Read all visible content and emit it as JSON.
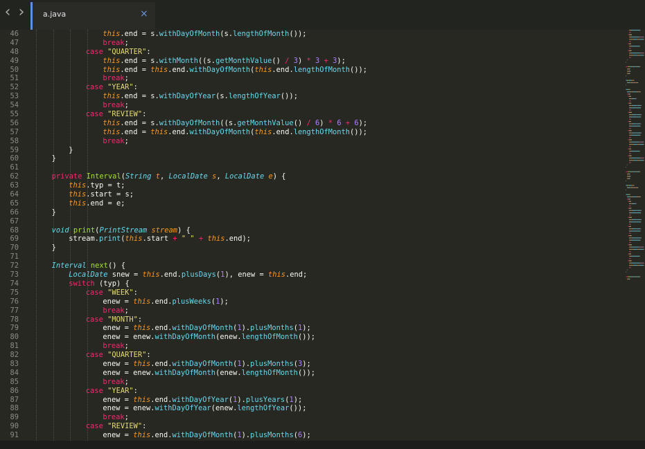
{
  "tabbar": {
    "back_glyph": "‹",
    "forward_glyph": "›",
    "tab": {
      "label": "a.java",
      "close_glyph": "×"
    }
  },
  "icons": [
    "chevron-left-icon",
    "chevron-right-icon",
    "close-icon"
  ],
  "colors": {
    "accent": "#5f8fe0",
    "background": "#272822",
    "keyword": "#f92672",
    "type": "#66d9ef",
    "function": "#a6e22e",
    "string": "#e6db74",
    "number": "#ae81ff",
    "this": "#fd971f"
  },
  "editor": {
    "lines": [
      {
        "n": "46",
        "i": 4,
        "t": [
          [
            "this",
            "this"
          ],
          [
            "pl",
            ".end = s."
          ],
          [
            "mt",
            "withDayOfMonth"
          ],
          [
            "pl",
            "(s."
          ],
          [
            "mt",
            "lengthOfMonth"
          ],
          [
            "pl",
            "());"
          ]
        ]
      },
      {
        "n": "47",
        "i": 4,
        "t": [
          [
            "kw",
            "break"
          ],
          [
            "pl",
            ";"
          ]
        ]
      },
      {
        "n": "48",
        "i": 3,
        "t": [
          [
            "kw",
            "case "
          ],
          [
            "str",
            "\"QUARTER\""
          ],
          [
            "pl",
            ":"
          ]
        ]
      },
      {
        "n": "49",
        "i": 4,
        "t": [
          [
            "this",
            "this"
          ],
          [
            "pl",
            ".end = s."
          ],
          [
            "mt",
            "withMonth"
          ],
          [
            "pl",
            "((s."
          ],
          [
            "mt",
            "getMonthValue"
          ],
          [
            "pl",
            "() "
          ],
          [
            "op",
            "/"
          ],
          [
            "pl",
            " "
          ],
          [
            "num",
            "3"
          ],
          [
            "pl",
            ") "
          ],
          [
            "op",
            "*"
          ],
          [
            "pl",
            " "
          ],
          [
            "num",
            "3"
          ],
          [
            "pl",
            " "
          ],
          [
            "op",
            "+"
          ],
          [
            "pl",
            " "
          ],
          [
            "num",
            "3"
          ],
          [
            "pl",
            ");"
          ]
        ]
      },
      {
        "n": "50",
        "i": 4,
        "t": [
          [
            "this",
            "this"
          ],
          [
            "pl",
            ".end = "
          ],
          [
            "this",
            "this"
          ],
          [
            "pl",
            ".end."
          ],
          [
            "mt",
            "withDayOfMonth"
          ],
          [
            "pl",
            "("
          ],
          [
            "this",
            "this"
          ],
          [
            "pl",
            ".end."
          ],
          [
            "mt",
            "lengthOfMonth"
          ],
          [
            "pl",
            "());"
          ]
        ]
      },
      {
        "n": "51",
        "i": 4,
        "t": [
          [
            "kw",
            "break"
          ],
          [
            "pl",
            ";"
          ]
        ]
      },
      {
        "n": "52",
        "i": 3,
        "t": [
          [
            "kw",
            "case "
          ],
          [
            "str",
            "\"YEAR\""
          ],
          [
            "pl",
            ":"
          ]
        ]
      },
      {
        "n": "53",
        "i": 4,
        "t": [
          [
            "this",
            "this"
          ],
          [
            "pl",
            ".end = s."
          ],
          [
            "mt",
            "withDayOfYear"
          ],
          [
            "pl",
            "(s."
          ],
          [
            "mt",
            "lengthOfYear"
          ],
          [
            "pl",
            "());"
          ]
        ]
      },
      {
        "n": "54",
        "i": 4,
        "t": [
          [
            "kw",
            "break"
          ],
          [
            "pl",
            ";"
          ]
        ]
      },
      {
        "n": "55",
        "i": 3,
        "t": [
          [
            "kw",
            "case "
          ],
          [
            "str",
            "\"REVIEW\""
          ],
          [
            "pl",
            ":"
          ]
        ]
      },
      {
        "n": "56",
        "i": 4,
        "t": [
          [
            "this",
            "this"
          ],
          [
            "pl",
            ".end = s."
          ],
          [
            "mt",
            "withDayOfMonth"
          ],
          [
            "pl",
            "((s."
          ],
          [
            "mt",
            "getMonthValue"
          ],
          [
            "pl",
            "() "
          ],
          [
            "op",
            "/"
          ],
          [
            "pl",
            " "
          ],
          [
            "num",
            "6"
          ],
          [
            "pl",
            ") "
          ],
          [
            "op",
            "*"
          ],
          [
            "pl",
            " "
          ],
          [
            "num",
            "6"
          ],
          [
            "pl",
            " "
          ],
          [
            "op",
            "+"
          ],
          [
            "pl",
            " "
          ],
          [
            "num",
            "6"
          ],
          [
            "pl",
            ");"
          ]
        ]
      },
      {
        "n": "57",
        "i": 4,
        "t": [
          [
            "this",
            "this"
          ],
          [
            "pl",
            ".end = "
          ],
          [
            "this",
            "this"
          ],
          [
            "pl",
            ".end."
          ],
          [
            "mt",
            "withDayOfMonth"
          ],
          [
            "pl",
            "("
          ],
          [
            "this",
            "this"
          ],
          [
            "pl",
            ".end."
          ],
          [
            "mt",
            "lengthOfMonth"
          ],
          [
            "pl",
            "());"
          ]
        ]
      },
      {
        "n": "58",
        "i": 4,
        "t": [
          [
            "kw",
            "break"
          ],
          [
            "pl",
            ";"
          ]
        ]
      },
      {
        "n": "59",
        "i": 2,
        "t": [
          [
            "pl",
            "}"
          ]
        ]
      },
      {
        "n": "60",
        "i": 1,
        "t": [
          [
            "pl",
            "}"
          ]
        ]
      },
      {
        "n": "61",
        "i": 0,
        "t": []
      },
      {
        "n": "62",
        "i": 1,
        "t": [
          [
            "kw",
            "private "
          ],
          [
            "fn",
            "Interval"
          ],
          [
            "pl",
            "("
          ],
          [
            "ty",
            "String"
          ],
          [
            "pl",
            " "
          ],
          [
            "par",
            "t"
          ],
          [
            "pl",
            ", "
          ],
          [
            "ty",
            "LocalDate"
          ],
          [
            "pl",
            " "
          ],
          [
            "par",
            "s"
          ],
          [
            "pl",
            ", "
          ],
          [
            "ty",
            "LocalDate"
          ],
          [
            "pl",
            " "
          ],
          [
            "par",
            "e"
          ],
          [
            "pl",
            ") {"
          ]
        ]
      },
      {
        "n": "63",
        "i": 2,
        "t": [
          [
            "this",
            "this"
          ],
          [
            "pl",
            ".typ = t;"
          ]
        ]
      },
      {
        "n": "64",
        "i": 2,
        "t": [
          [
            "this",
            "this"
          ],
          [
            "pl",
            ".start = s;"
          ]
        ]
      },
      {
        "n": "65",
        "i": 2,
        "t": [
          [
            "this",
            "this"
          ],
          [
            "pl",
            ".end = e;"
          ]
        ]
      },
      {
        "n": "66",
        "i": 1,
        "t": [
          [
            "pl",
            "}"
          ]
        ]
      },
      {
        "n": "67",
        "i": 0,
        "t": []
      },
      {
        "n": "68",
        "i": 1,
        "t": [
          [
            "ty",
            "void"
          ],
          [
            "pl",
            " "
          ],
          [
            "fn",
            "print"
          ],
          [
            "pl",
            "("
          ],
          [
            "ty",
            "PrintStream"
          ],
          [
            "pl",
            " "
          ],
          [
            "par",
            "stream"
          ],
          [
            "pl",
            ") {"
          ]
        ]
      },
      {
        "n": "69",
        "i": 2,
        "t": [
          [
            "pl",
            "stream."
          ],
          [
            "mt",
            "print"
          ],
          [
            "pl",
            "("
          ],
          [
            "this",
            "this"
          ],
          [
            "pl",
            ".start "
          ],
          [
            "op",
            "+"
          ],
          [
            "pl",
            " "
          ],
          [
            "str",
            "\" \""
          ],
          [
            "pl",
            " "
          ],
          [
            "op",
            "+"
          ],
          [
            "pl",
            " "
          ],
          [
            "this",
            "this"
          ],
          [
            "pl",
            ".end);"
          ]
        ]
      },
      {
        "n": "70",
        "i": 1,
        "t": [
          [
            "pl",
            "}"
          ]
        ]
      },
      {
        "n": "71",
        "i": 0,
        "t": []
      },
      {
        "n": "72",
        "i": 1,
        "t": [
          [
            "ty",
            "Interval"
          ],
          [
            "pl",
            " "
          ],
          [
            "fn",
            "next"
          ],
          [
            "pl",
            "() {"
          ]
        ]
      },
      {
        "n": "73",
        "i": 2,
        "t": [
          [
            "ty",
            "LocalDate"
          ],
          [
            "pl",
            " snew = "
          ],
          [
            "this",
            "this"
          ],
          [
            "pl",
            ".end."
          ],
          [
            "mt",
            "plusDays"
          ],
          [
            "pl",
            "("
          ],
          [
            "num",
            "1"
          ],
          [
            "pl",
            "), enew = "
          ],
          [
            "this",
            "this"
          ],
          [
            "pl",
            ".end;"
          ]
        ]
      },
      {
        "n": "74",
        "i": 2,
        "t": [
          [
            "kw",
            "switch"
          ],
          [
            "pl",
            " (typ) {"
          ]
        ]
      },
      {
        "n": "75",
        "i": 3,
        "t": [
          [
            "kw",
            "case "
          ],
          [
            "str",
            "\"WEEK\""
          ],
          [
            "pl",
            ":"
          ]
        ]
      },
      {
        "n": "76",
        "i": 4,
        "t": [
          [
            "pl",
            "enew = "
          ],
          [
            "this",
            "this"
          ],
          [
            "pl",
            ".end."
          ],
          [
            "mt",
            "plusWeeks"
          ],
          [
            "pl",
            "("
          ],
          [
            "num",
            "1"
          ],
          [
            "pl",
            ");"
          ]
        ]
      },
      {
        "n": "77",
        "i": 4,
        "t": [
          [
            "kw",
            "break"
          ],
          [
            "pl",
            ";"
          ]
        ]
      },
      {
        "n": "78",
        "i": 3,
        "t": [
          [
            "kw",
            "case "
          ],
          [
            "str",
            "\"MONTH\""
          ],
          [
            "pl",
            ":"
          ]
        ]
      },
      {
        "n": "79",
        "i": 4,
        "t": [
          [
            "pl",
            "enew = "
          ],
          [
            "this",
            "this"
          ],
          [
            "pl",
            ".end."
          ],
          [
            "mt",
            "withDayOfMonth"
          ],
          [
            "pl",
            "("
          ],
          [
            "num",
            "1"
          ],
          [
            "pl",
            ")."
          ],
          [
            "mt",
            "plusMonths"
          ],
          [
            "pl",
            "("
          ],
          [
            "num",
            "1"
          ],
          [
            "pl",
            ");"
          ]
        ]
      },
      {
        "n": "80",
        "i": 4,
        "t": [
          [
            "pl",
            "enew = enew."
          ],
          [
            "mt",
            "withDayOfMonth"
          ],
          [
            "pl",
            "(enew."
          ],
          [
            "mt",
            "lengthOfMonth"
          ],
          [
            "pl",
            "());"
          ]
        ]
      },
      {
        "n": "81",
        "i": 4,
        "t": [
          [
            "kw",
            "break"
          ],
          [
            "pl",
            ";"
          ]
        ]
      },
      {
        "n": "82",
        "i": 3,
        "t": [
          [
            "kw",
            "case "
          ],
          [
            "str",
            "\"QUARTER\""
          ],
          [
            "pl",
            ":"
          ]
        ]
      },
      {
        "n": "83",
        "i": 4,
        "t": [
          [
            "pl",
            "enew = "
          ],
          [
            "this",
            "this"
          ],
          [
            "pl",
            ".end."
          ],
          [
            "mt",
            "withDayOfMonth"
          ],
          [
            "pl",
            "("
          ],
          [
            "num",
            "1"
          ],
          [
            "pl",
            ")."
          ],
          [
            "mt",
            "plusMonths"
          ],
          [
            "pl",
            "("
          ],
          [
            "num",
            "3"
          ],
          [
            "pl",
            ");"
          ]
        ]
      },
      {
        "n": "84",
        "i": 4,
        "t": [
          [
            "pl",
            "enew = enew."
          ],
          [
            "mt",
            "withDayOfMonth"
          ],
          [
            "pl",
            "(enew."
          ],
          [
            "mt",
            "lengthOfMonth"
          ],
          [
            "pl",
            "());"
          ]
        ]
      },
      {
        "n": "85",
        "i": 4,
        "t": [
          [
            "kw",
            "break"
          ],
          [
            "pl",
            ";"
          ]
        ]
      },
      {
        "n": "86",
        "i": 3,
        "t": [
          [
            "kw",
            "case "
          ],
          [
            "str",
            "\"YEAR\""
          ],
          [
            "pl",
            ":"
          ]
        ]
      },
      {
        "n": "87",
        "i": 4,
        "t": [
          [
            "pl",
            "enew = "
          ],
          [
            "this",
            "this"
          ],
          [
            "pl",
            ".end."
          ],
          [
            "mt",
            "withDayOfYear"
          ],
          [
            "pl",
            "("
          ],
          [
            "num",
            "1"
          ],
          [
            "pl",
            ")."
          ],
          [
            "mt",
            "plusYears"
          ],
          [
            "pl",
            "("
          ],
          [
            "num",
            "1"
          ],
          [
            "pl",
            ");"
          ]
        ]
      },
      {
        "n": "88",
        "i": 4,
        "t": [
          [
            "pl",
            "enew = enew."
          ],
          [
            "mt",
            "withDayOfYear"
          ],
          [
            "pl",
            "(enew."
          ],
          [
            "mt",
            "lengthOfYear"
          ],
          [
            "pl",
            "());"
          ]
        ]
      },
      {
        "n": "89",
        "i": 4,
        "t": [
          [
            "kw",
            "break"
          ],
          [
            "pl",
            ";"
          ]
        ]
      },
      {
        "n": "90",
        "i": 3,
        "t": [
          [
            "kw",
            "case "
          ],
          [
            "str",
            "\"REVIEW\""
          ],
          [
            "pl",
            ":"
          ]
        ]
      },
      {
        "n": "91",
        "i": 4,
        "t": [
          [
            "pl",
            "enew = "
          ],
          [
            "this",
            "this"
          ],
          [
            "pl",
            ".end."
          ],
          [
            "mt",
            "withDayOfMonth"
          ],
          [
            "pl",
            "("
          ],
          [
            "num",
            "1"
          ],
          [
            "pl",
            ")."
          ],
          [
            "mt",
            "plusMonths"
          ],
          [
            "pl",
            "("
          ],
          [
            "num",
            "6"
          ],
          [
            "pl",
            ");"
          ]
        ]
      }
    ]
  }
}
